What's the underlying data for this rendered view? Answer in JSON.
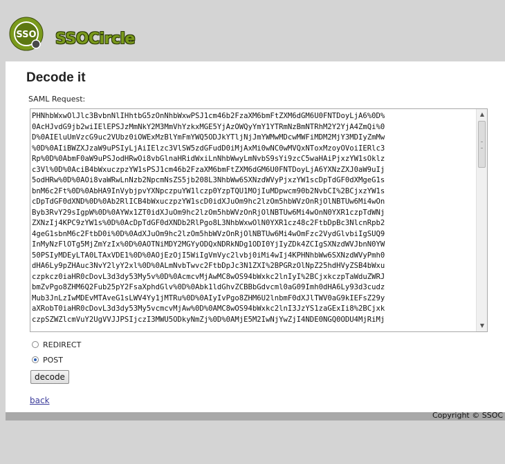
{
  "header": {
    "logo_text": "SSO",
    "brand": "SSOCircle"
  },
  "main": {
    "title": "Decode it",
    "saml_label": "SAML Request:",
    "saml_value": "PHNhbWxwOlJlc3BvbnNlIHhtbG5zOnNhbWxwPSJ1cm46b2FzaXM6bmFtZXM6dGM6U0FNTDoyLjA6%0D%\n0AcHJvdG9jb2wiIElEPSJzMmNkY2M3MmVhYzkxMGE5YjAzOWQyYmY1YTRmNzBmNTRhM2Y2YjA4ZmQi%0\nD%0AIEluUmVzcG9uc2VUbz0iOWExMzBlYmFmYWQ5ODJkYTljNjJmYWMwMDcwMWFiMDM2MjY3MDIyZmMw\n%0D%0AIiBWZXJzaW9uPSIyLjAiIElzc3VlSW5zdGFudD0iMjAxMi0wNC0wMVQxNToxMzoyOVoiIERlc3\nRp%0D%0AbmF0aW9uPSJodHRwOi8vbGlnaHRidWxiLnNhbWwyLmNvbS9sYi9zcC5waHAiPjxzYW1sOklz\nc3Vl%0D%0AciB4bWxuczpzYW1sPSJ1cm46b2FzaXM6bmFtZXM6dGM6U0FNTDoyLjA6YXNzZXJ0aW9uIj\n5odHRw%0D%0AOi8vaWRwLnNzb2NpcmNsZS5jb208L3NhbWw6SXNzdWVyPjxzYW1scDpTdGF0dXMgeG1s\nbnM6c2Ft%0D%0AbHA9InVybjpvYXNpczpuYW1lczp0YzpTQU1MOjIuMDpwcm90b2NvbCI%2BCjxzYW1s\ncDpTdGF0dXND%0D%0Ab2RlICB4bWxuczpzYW1scD0idXJuOm9hc2lzOm5hbWVzOnRjOlNBTUw6Mi4wOn\nByb3RvY29sIgpW%0D%0AYWx1ZT0idXJuOm9hc2lzOm5hbWVzOnRjOlNBTUw6Mi4wOnN0YXR1czpTdWNj\nZXNzIj4KPC9zYW1s%0D%0AcDpTdGF0dXNDb2RlPgo8L3NhbWxwOlN0YXR1cz48c2FtbDpBc3NlcnRpb2\n4geG1sbnM6c2FtbD0i%0D%0AdXJuOm9hc2lzOm5hbWVzOnRjOlNBTUw6Mi4wOmFzc2VydGlvbiIgSUQ9\nInMyNzFlOTg5MjZmYzIx%0D%0AOTNiMDY2MGYyODQxNDRkNDg1ODI0YjIyZDk4ZCIgSXNzdWVJbnN0YW\n50PSIyMDEyLTA0LTAxVDE1%0D%0AOjEzOjI5WiIgVmVyc2lvbj0iMi4wIj4KPHNhbWw6SXNzdWVyPmh0\ndHA6Ly9pZHAuc3NvY2lyY2xl%0D%0ALmNvbTwvc2FtbDpJc3N1ZXI%2BPGRzOlNpZ25hdHVyZSB4bWxu\nczpkcz0iaHR0cDovL3d3dy53My5v%0D%0AcmcvMjAwMC8wOS94bWxkc2lnIyI%2BCjxkczpTaWduZWRJ\nbmZvPgo8ZHM6Q2Fub25pY2FsaXphdGlv%0D%0Abk1ldGhvZCBBbGdvcml0aG09Imh0dHA6Ly93d3cudz\nMub3JnLzIwMDEvMTAveG1sLWV4Yy1jMTRu%0D%0AIyIvPgo8ZHM6U2lnbmF0dXJlTWV0aG9kIEFsZ29y\naXRobT0iaHR0cDovL3d3dy53My5vcmcvMjAw%0D%0AMC8wOS94bWxkc2lnI3JzYS1zaGExIi8%2BCjxk\nczpSZWZlcmVuY2UgVVJJPSIjczI3MWU5ODkyNmZj%0D%0AMjE5M2IwNjYwZjI4NDE0NGQ0ODU4MjRiMj",
    "radio_redirect": "REDIRECT",
    "radio_post": "POST",
    "decode_label": "decode",
    "back_label": "back"
  },
  "footer": {
    "copyright": "Copyright © SSOC"
  },
  "colors": {
    "page_bg": "#d4d4d4",
    "content_bg": "#ffffff",
    "brand_green": "#7a9a1c",
    "link": "#3a3a9a"
  }
}
